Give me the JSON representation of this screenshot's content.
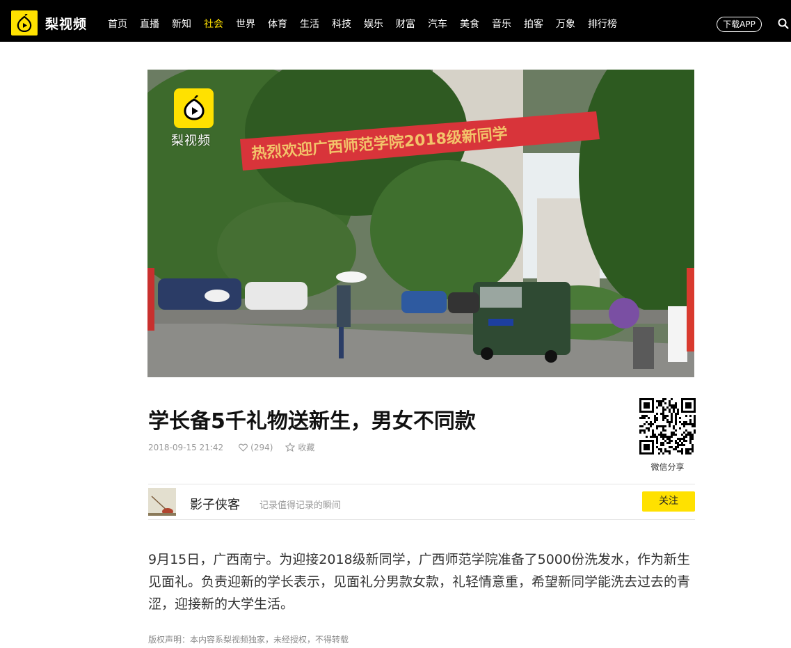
{
  "brand": {
    "name": "梨视频",
    "accent": "#ffe100"
  },
  "nav": {
    "items": [
      {
        "label": "首页"
      },
      {
        "label": "直播"
      },
      {
        "label": "新知"
      },
      {
        "label": "社会",
        "active": true
      },
      {
        "label": "世界"
      },
      {
        "label": "体育"
      },
      {
        "label": "生活"
      },
      {
        "label": "科技"
      },
      {
        "label": "娱乐"
      },
      {
        "label": "财富"
      },
      {
        "label": "汽车"
      },
      {
        "label": "美食"
      },
      {
        "label": "音乐"
      },
      {
        "label": "拍客"
      },
      {
        "label": "万象"
      },
      {
        "label": "排行榜"
      }
    ],
    "download_label": "下载APP",
    "search_icon": "search-icon"
  },
  "video": {
    "watermark": "梨视频",
    "banner_text": "热烈欢迎广西师范学院2018级新同学"
  },
  "article": {
    "title": "学长备5千礼物送新生，男女不同款",
    "date": "2018-09-15 21:42",
    "likes": "(294)",
    "favorite_label": "收藏",
    "share_label": "微信分享",
    "summary": "9月15日，广西南宁。为迎接2018级新同学，广西师范学院准备了5000份洗发水，作为新生见面礼。负责迎新的学长表示，见面礼分男款女款，礼轻情意重，希望新同学能洗去过去的青涩，迎接新的大学生活。",
    "copyright": "版权声明：本内容系梨视频独家，未经授权，不得转载"
  },
  "author": {
    "name": "影子侠客",
    "description": "记录值得记录的瞬间",
    "follow_label": "关注"
  }
}
